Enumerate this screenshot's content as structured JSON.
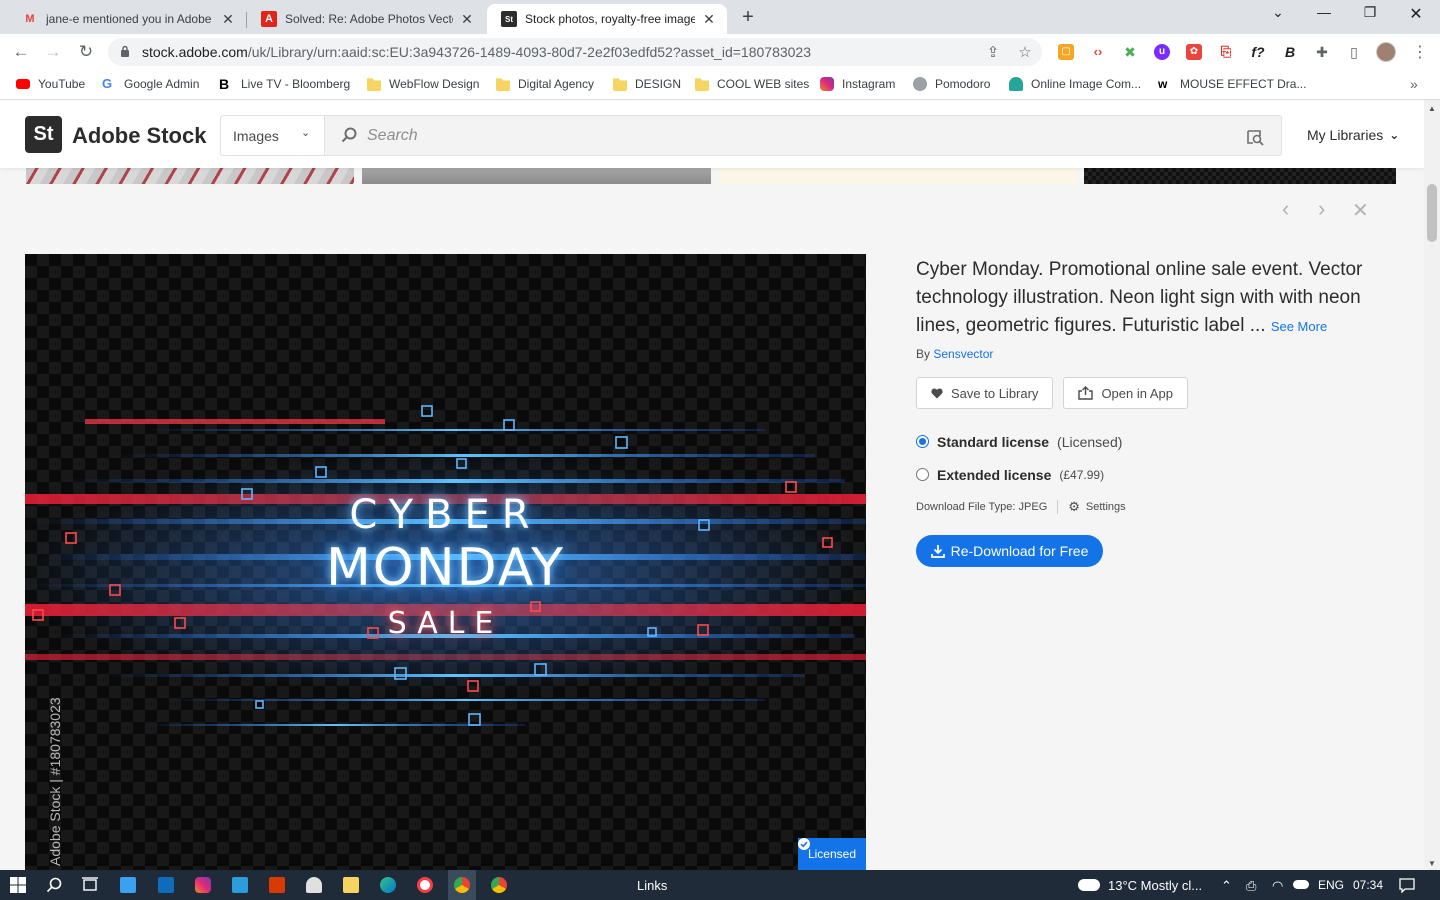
{
  "browser": {
    "tabs": [
      {
        "title": "jane-e mentioned you in Adobe S",
        "icon": "gmail-icon",
        "active": false
      },
      {
        "title": "Solved: Re: Adobe Photos Vector",
        "icon": "adobe-icon",
        "active": false
      },
      {
        "title": "Stock photos, royalty-free image",
        "icon": "adobe-stock-icon",
        "active": true
      }
    ],
    "url_host": "stock.adobe.com",
    "url_path": "/uk/Library/urn:aaid:sc:EU:3a943726-1489-4093-80d7-2e2f03edfd52?asset_id=180783023",
    "bookmarks": [
      {
        "label": "YouTube",
        "icon": "youtube-icon"
      },
      {
        "label": "Google Admin",
        "icon": "google-icon"
      },
      {
        "label": "Live TV - Bloomberg",
        "icon": "bloomberg-icon"
      },
      {
        "label": "WebFlow Design",
        "icon": "folder-icon"
      },
      {
        "label": "Digital Agency",
        "icon": "folder-icon"
      },
      {
        "label": "DESIGN",
        "icon": "folder-icon"
      },
      {
        "label": "COOL WEB sites",
        "icon": "folder-icon"
      },
      {
        "label": "Instagram",
        "icon": "instagram-icon"
      },
      {
        "label": "Pomodoro",
        "icon": "pomodoro-icon"
      },
      {
        "label": "Online Image Com...",
        "icon": "image-compress-icon"
      },
      {
        "label": "MOUSE EFFECT Dra...",
        "icon": "w-icon"
      }
    ]
  },
  "header": {
    "logo_mark": "St",
    "logo_text": "Adobe Stock",
    "category": "Images",
    "search_placeholder": "Search",
    "my_libraries": "My Libraries"
  },
  "asset": {
    "title": "Cyber Monday. Promotional online sale event. Vector technology illustration. Neon light sign with with neon lines, geometric figures. Futuristic label ...",
    "see_more": "See More",
    "by_prefix": "By",
    "author": "Sensvector",
    "image_text": {
      "line1": "CYBER",
      "line2": "MONDAY",
      "line3": "SALE"
    },
    "watermark": "Adobe Stock | #180783023",
    "licensed_badge": "Licensed"
  },
  "actions": {
    "save_to_library": "Save to Library",
    "open_in_app": "Open in App"
  },
  "licenses": [
    {
      "name": "Standard license",
      "note": "(Licensed)",
      "selected": true
    },
    {
      "name": "Extended license",
      "note": "(£47.99)",
      "selected": false
    }
  ],
  "download": {
    "file_type_label": "Download File Type: JPEG",
    "settings": "Settings",
    "redownload": "Re-Download for Free"
  },
  "taskbar": {
    "links_label": "Links",
    "weather": "13°C  Mostly cl...",
    "language": "ENG",
    "time": "07:34"
  },
  "colors": {
    "accent": "#1473e6",
    "taskbar": "#1f2b38"
  }
}
